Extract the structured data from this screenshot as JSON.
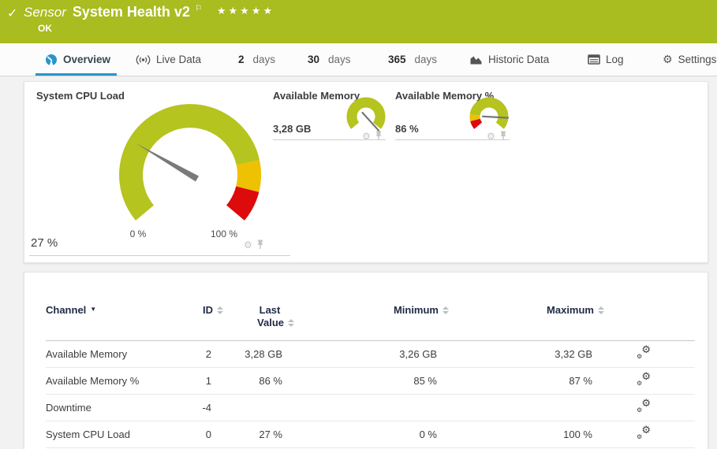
{
  "colors": {
    "header_green": "#a9bc20",
    "gauge_green": "#b5c41e",
    "warning_yellow": "#eec102",
    "error_red": "#dd0b0b",
    "tab_active_blue": "#2596cd"
  },
  "glyphs": {
    "check": "✓",
    "flag": "⚐",
    "stars": "★★★★★",
    "gear": "⚙",
    "caret_down": "▼"
  },
  "topbar": {
    "kind": "Sensor",
    "title": "System Health v2",
    "status": "OK"
  },
  "tabs": {
    "overview": {
      "label": "Overview"
    },
    "live": {
      "label": "Live Data"
    },
    "d2": {
      "num": "2",
      "unit": "days"
    },
    "d30": {
      "num": "30",
      "unit": "days"
    },
    "d365": {
      "num": "365",
      "unit": "days"
    },
    "historic": {
      "label": "Historic Data"
    },
    "log": {
      "label": "Log"
    },
    "settings": {
      "label": "Settings"
    }
  },
  "gauges": {
    "cpu": {
      "title": "System CPU Load",
      "value": "27 %",
      "percent": 27,
      "min_label": "0 %",
      "max_label": "100 %"
    },
    "memory": {
      "title": "Available Memory",
      "value": "3,28 GB"
    },
    "memory_pct": {
      "title": "Available Memory %",
      "value": "86 %",
      "percent": 86
    }
  },
  "table": {
    "headers": {
      "channel": "Channel",
      "id": "ID",
      "last1": "Last",
      "last2": "Value",
      "min": "Minimum",
      "max": "Maximum"
    },
    "rows": [
      {
        "channel": "Available Memory",
        "id": "2",
        "last": "3,28 GB",
        "min": "3,26 GB",
        "max": "3,32 GB"
      },
      {
        "channel": "Available Memory %",
        "id": "1",
        "last": "86 %",
        "min": "85 %",
        "max": "87 %"
      },
      {
        "channel": "Downtime",
        "id": "-4",
        "last": "",
        "min": "",
        "max": ""
      },
      {
        "channel": "System CPU Load",
        "id": "0",
        "last": "27 %",
        "min": "0 %",
        "max": "100 %"
      }
    ]
  }
}
